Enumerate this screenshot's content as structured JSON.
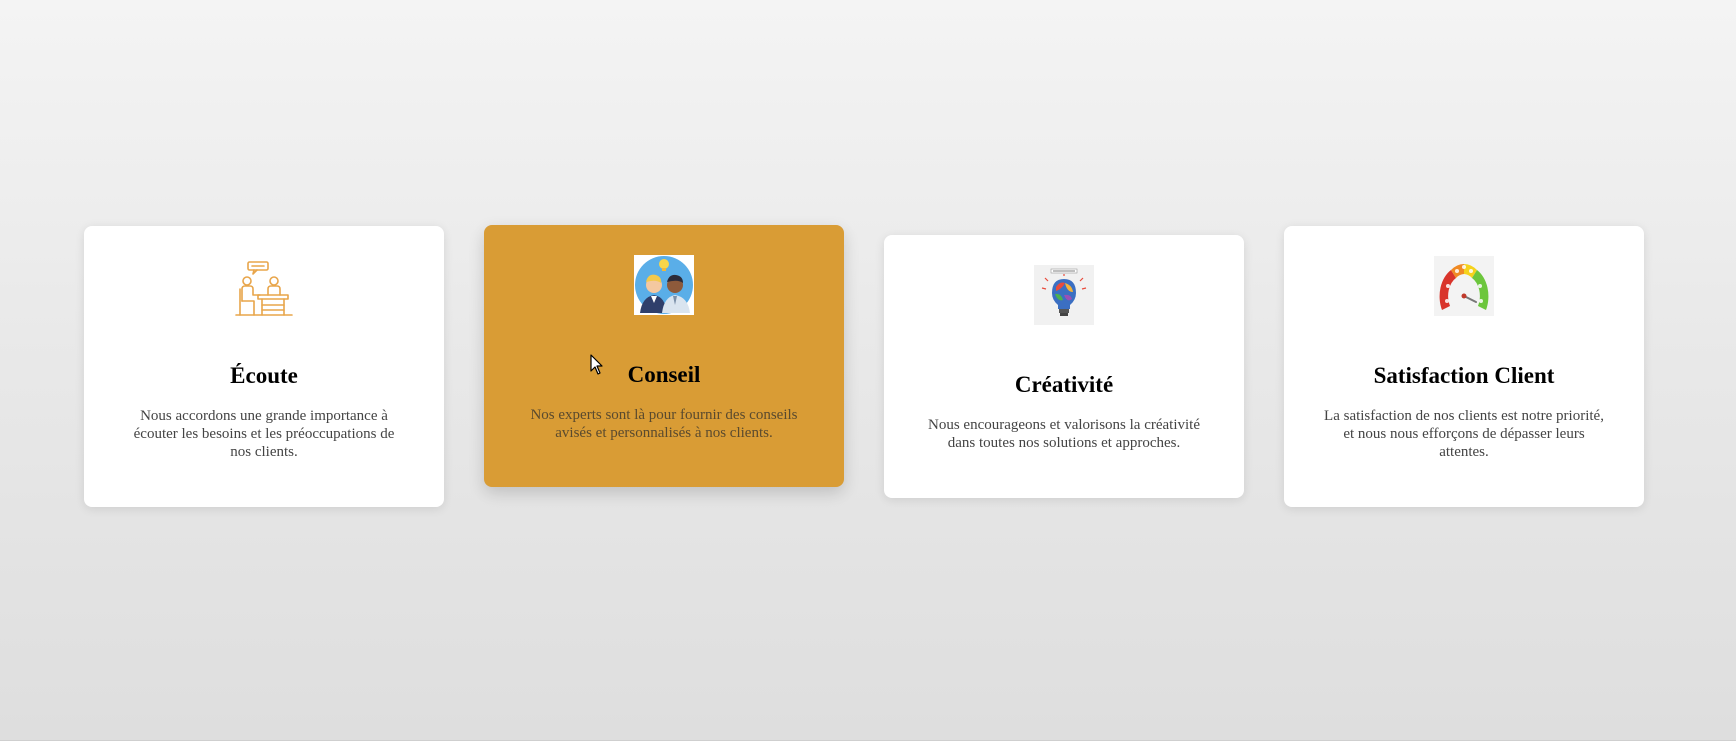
{
  "cards": [
    {
      "title": "Écoute",
      "text": "Nous accordons une grande importance à écouter les besoins et les préoccupations de nos clients.",
      "icon": "listening-desk-icon"
    },
    {
      "title": "Conseil",
      "text": "Nos experts sont là pour fournir des conseils avisés et personnalisés à nos clients.",
      "icon": "advisors-lightbulb-icon"
    },
    {
      "title": "Créativité",
      "text": "Nous encourageons et valorisons la créativité dans toutes nos solutions et approches.",
      "icon": "creative-lightbulb-icon"
    },
    {
      "title": "Satisfaction Client",
      "text": "La satisfaction de nos clients est notre priorité, et nous nous efforçons de dépasser leurs attentes.",
      "icon": "satisfaction-gauge-icon"
    }
  ],
  "colors": {
    "active_card": "#d99c35",
    "card": "#ffffff",
    "icon_outline": "#e8a54a"
  }
}
